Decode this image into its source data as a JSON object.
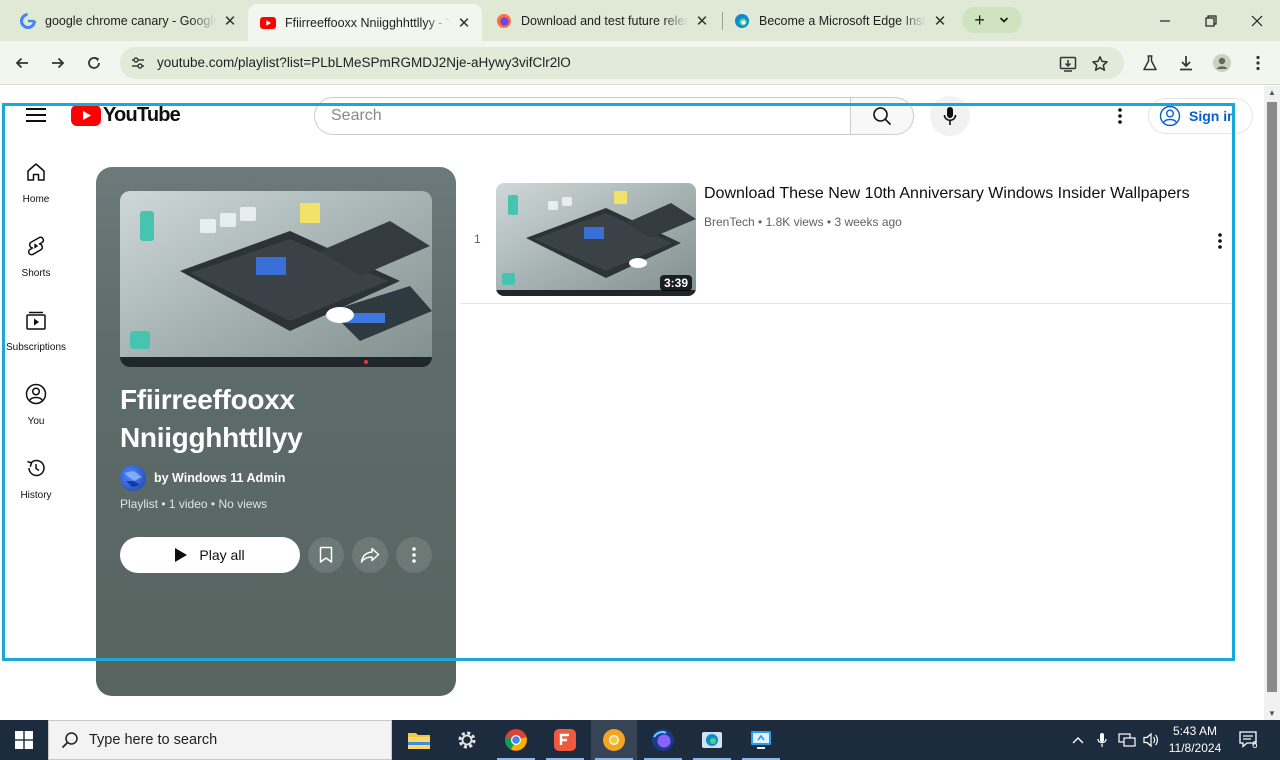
{
  "browser": {
    "tabs": [
      {
        "title": "google chrome canary - Google Search",
        "favicon": "google-icon",
        "active": false
      },
      {
        "title": "Ffiirreeffooxx Nniigghhttllyy - YouTube",
        "favicon": "youtube-icon",
        "active": true
      },
      {
        "title": "Download and test future releases",
        "favicon": "firefox-icon",
        "active": false
      },
      {
        "title": "Become a Microsoft Edge Insider",
        "favicon": "edge-icon",
        "active": false
      }
    ],
    "url": "youtube.com/playlist?list=PLbLMeSPmRGMDJ2Nje-aHywy3vifClr2lO",
    "newtab_label": "+",
    "tab_close": "✕"
  },
  "youtube": {
    "logo_text": "YouTube",
    "search_placeholder": "Search",
    "signin_label": "Sign in",
    "guide": [
      {
        "label": "Home",
        "icon": "home-icon"
      },
      {
        "label": "Shorts",
        "icon": "shorts-icon"
      },
      {
        "label": "Subscriptions",
        "icon": "subscriptions-icon"
      },
      {
        "label": "You",
        "icon": "you-icon"
      },
      {
        "label": "History",
        "icon": "history-icon"
      }
    ],
    "playlist": {
      "title": "Ffiirreeffooxx Nniigghhttllyy",
      "owner": "by Windows 11 Admin",
      "meta": "Playlist • 1 video • No views",
      "play_all_label": "Play all"
    },
    "videos": [
      {
        "index": "1",
        "title": "Download These New 10th Anniversary Windows Insider Wallpapers",
        "meta": "BrenTech • 1.8K views • 3 weeks ago",
        "duration": "3:39"
      }
    ]
  },
  "taskbar": {
    "search_placeholder": "Type here to search",
    "time": "5:43 AM",
    "date": "11/8/2024",
    "notification_count": "6"
  },
  "colors": {
    "highlight": "#19a9d8",
    "youtube_red": "#ff0000",
    "signin_blue": "#065fd4",
    "chrome_frame": "#dfe9d6"
  }
}
